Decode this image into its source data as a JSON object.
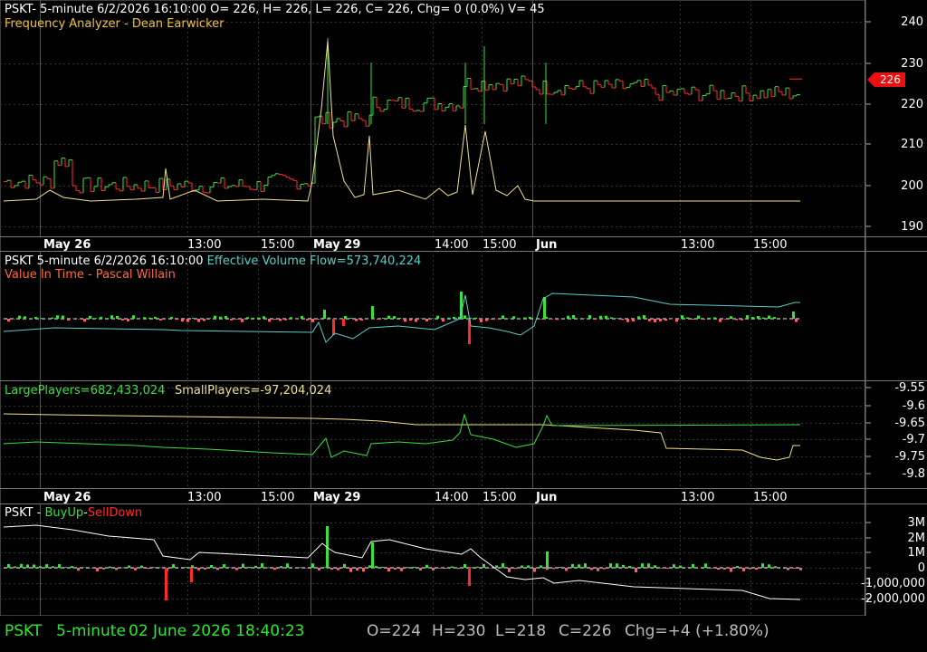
{
  "colors": {
    "bg": "#000000",
    "grid": "#3c3c3c",
    "axis_text": "#ffffff",
    "white": "#ffffff",
    "green": "#3be03b",
    "red": "#ff2b2b",
    "yellow": "#f0e08c",
    "orange": "#ff7a3c",
    "cyan": "#55d0c8",
    "bright_green": "#2ee82e"
  },
  "panel1": {
    "header": "PSKT- 5-minute 6/2/2026 16:10:00 O= 226, H= 226, L= 226, C= 226, Chg= 0 (0.0%) V= 45",
    "indicator": "Frequency Analyzer - Dean Earwicker",
    "y_ticks": [
      "240",
      "230",
      "220",
      "210",
      "200",
      "190"
    ],
    "last_price": "226",
    "time_labels": [
      "May 26",
      "13:00",
      "15:00",
      "May 29",
      "14:00",
      "15:00",
      "Jun",
      "13:00",
      "15:00"
    ]
  },
  "panel2": {
    "header_prefix": "PSKT 5-minute  6/2/2026 16:10:00",
    "header_value": "Effective Volume Flow=573,740,224",
    "indicator": "Value In Time - Pascal Willain"
  },
  "panel3": {
    "large": "LargePlayers=682,433,024",
    "small": "SmallPlayers=-97,204,024",
    "y_ticks": [
      "-9.55",
      "-9.6",
      "-9.65",
      "-9.7",
      "-9.75",
      "-9.8"
    ],
    "time_labels": [
      "May 26",
      "13:00",
      "15:00",
      "May 29",
      "14:00",
      "15:00",
      "Jun",
      "13:00",
      "15:00"
    ]
  },
  "panel4": {
    "symbol": "PSKT - ",
    "buy": "BuyUp",
    "dash": "-",
    "sell": "SellDown",
    "y_ticks": [
      "3M",
      "2M",
      "1M",
      "0",
      "-1,000,000",
      "-2,000,000"
    ]
  },
  "status": {
    "symbol": "PSKT",
    "interval": "5-minute",
    "datetime": "02 June 2026 18:40:23",
    "open": "O=224",
    "high": "H=230",
    "low": "L=218",
    "close": "C=226",
    "change": "Chg=+4 (+1.80%)"
  }
}
